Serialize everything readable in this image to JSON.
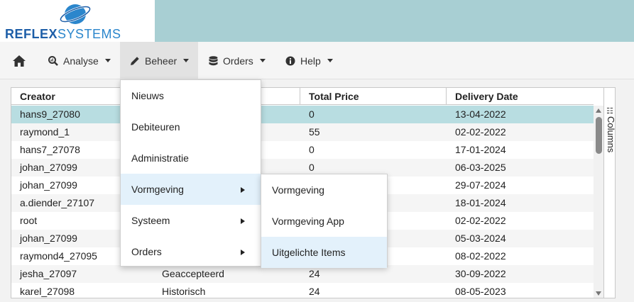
{
  "logo": {
    "word_bold": "REFLEX",
    "word_light": "SYSTEMS",
    "brand_color": "#1d5ea8"
  },
  "navbar": {
    "home_icon": "home-icon",
    "items": [
      {
        "label": "Analyse",
        "icon": "search-chart-icon"
      },
      {
        "label": "Beheer",
        "icon": "pencil-icon"
      },
      {
        "label": "Orders",
        "icon": "database-icon"
      },
      {
        "label": "Help",
        "icon": "info-icon"
      }
    ]
  },
  "grid": {
    "headers": [
      "Creator",
      "Total Price",
      "Delivery Date"
    ],
    "rows": [
      {
        "creator": "hans9_27080",
        "status": "",
        "price": "0",
        "date": "13-04-2022"
      },
      {
        "creator": "raymond_1",
        "status": "",
        "price": "55",
        "date": "02-02-2022"
      },
      {
        "creator": "hans7_27078",
        "status": "",
        "price": "0",
        "date": "17-01-2024"
      },
      {
        "creator": "johan_27099",
        "status": "",
        "price": "0",
        "date": "06-03-2025"
      },
      {
        "creator": "johan_27099",
        "status": "",
        "price": "",
        "date": "29-07-2024"
      },
      {
        "creator": "a.diender_27107",
        "status": "",
        "price": "",
        "date": "18-01-2024"
      },
      {
        "creator": "root",
        "status": "",
        "price": "",
        "date": "02-02-2022"
      },
      {
        "creator": "johan_27099",
        "status": "",
        "price": "",
        "date": "05-03-2024"
      },
      {
        "creator": "raymond4_27095",
        "status": "",
        "price": "",
        "date": "08-02-2022"
      },
      {
        "creator": "jesha_27097",
        "status": "Geaccepteerd",
        "price": "24",
        "date": "30-09-2022"
      },
      {
        "creator": "karel_27098",
        "status": "Historisch",
        "price": "24",
        "date": "08-05-2023"
      }
    ],
    "selected_row": 0,
    "selected_color": "#b8dde1",
    "columns_label": "Columns"
  },
  "menu_beheer": {
    "items": [
      "Nieuws",
      "Debiteuren",
      "Administratie",
      "Vormgeving",
      "Systeem",
      "Orders"
    ],
    "highlighted": 3
  },
  "menu_vormgeving": {
    "items": [
      "Vormgeving",
      "Vormgeving App",
      "Uitgelichte Items"
    ],
    "highlighted": 2
  }
}
